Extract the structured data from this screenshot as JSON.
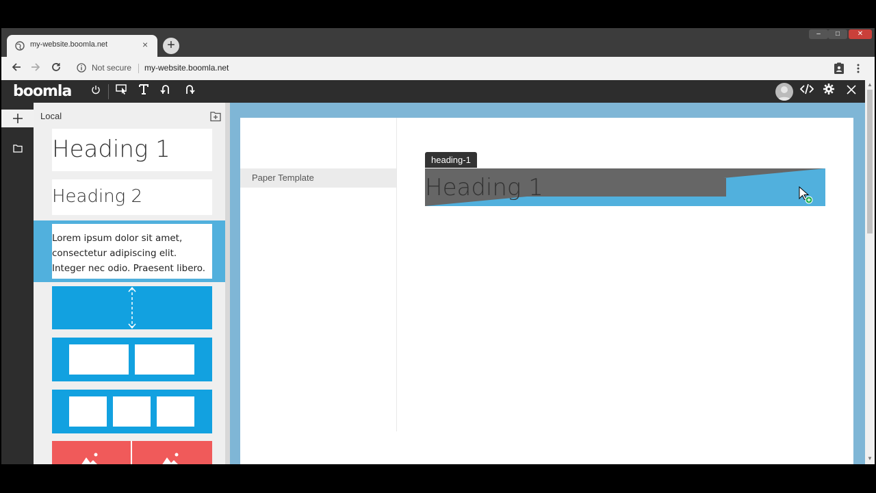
{
  "browser": {
    "tab_title": "my-website.boomla.net",
    "tab_close": "×",
    "new_tab": "+",
    "security_label": "Not secure",
    "url": "my-website.boomla.net",
    "window_buttons": [
      "–",
      "□",
      "✕"
    ]
  },
  "boomla_toolbar": {
    "logo": "boomla",
    "tools": [
      "power-icon",
      "select-icon",
      "text-icon",
      "undo-icon",
      "redo-icon"
    ],
    "right_tools": [
      "avatar",
      "code-icon",
      "gear-icon",
      "close-icon"
    ]
  },
  "left_panel": {
    "header": "Local",
    "items": [
      {
        "type": "heading-1",
        "label": "Heading 1"
      },
      {
        "type": "heading-2",
        "label": "Heading 2"
      },
      {
        "type": "paragraph",
        "label": "Lorem ipsum dolor sit amet, consectetur adipiscing elit. Integer nec odio. Praesent libero."
      },
      {
        "type": "spacer"
      },
      {
        "type": "two-columns"
      },
      {
        "type": "three-columns"
      },
      {
        "type": "gallery"
      }
    ]
  },
  "page": {
    "sidebar_item": "Paper Template",
    "badge": "heading-1",
    "heading": "Heading 1"
  },
  "colors": {
    "accent": "#12a1e0",
    "canvas": "#7fb6d6",
    "gallery": "#f05a5a",
    "drop_indicator": "#51b0dd"
  }
}
